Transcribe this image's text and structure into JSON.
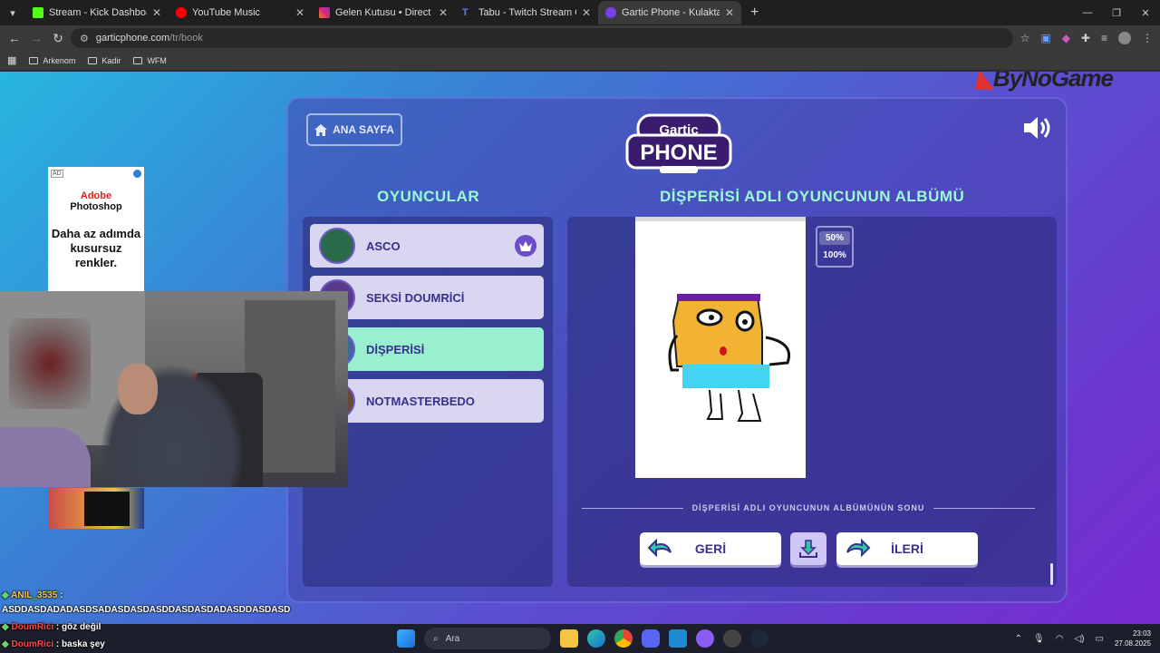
{
  "browser": {
    "tabs": [
      {
        "title": "Stream - Kick Dashboard",
        "color": "#53fc18"
      },
      {
        "title": "YouTube Music",
        "color": "#ff0000"
      },
      {
        "title": "Gelen Kutusu • Direct",
        "color": "#d62976"
      },
      {
        "title": "Tabu - Twitch Stream Games",
        "color": "#3a5bd9"
      },
      {
        "title": "Gartic Phone - Kulaktan Kulağa",
        "color": "#7b3fe4"
      }
    ],
    "url_host": "garticphone.com",
    "url_path": "/tr/book",
    "bookmarks": [
      "Arkenom",
      "Kadir",
      "WFM"
    ]
  },
  "overlay": {
    "sponsor": "ByNoGame",
    "ad": {
      "badge": "AD",
      "brand_line1": "Adobe",
      "brand_line2": "Photoshop",
      "copy": "Daha az adımda kusursuz renkler."
    },
    "chat": [
      {
        "user": "ANIL_3535",
        "sep": " :",
        "message": "ASDDASDADADASDSADASDASDASDDASDASDADASDDASDASD"
      },
      {
        "user": "DoumRici",
        "sep": " : ",
        "message": "göz değil"
      },
      {
        "user": "DoumRici",
        "sep": " : ",
        "message": "baska şey"
      }
    ]
  },
  "game": {
    "home_label": "ANA SAYFA",
    "logo_top": "Gartic",
    "logo_bottom": "PHONE",
    "players_heading": "OYUNCULAR",
    "album_heading": "DİŞPERİSİ ADLI OYUNCUNUN ALBÜMÜ",
    "players": [
      {
        "name": "ASCO",
        "host": true,
        "active": false
      },
      {
        "name": "SEKSİ DOUMRİCİ",
        "host": false,
        "active": false
      },
      {
        "name": "DİŞPERİSİ",
        "host": false,
        "active": true
      },
      {
        "name": "NOTMASTERBEDO",
        "host": false,
        "active": false
      }
    ],
    "zoom_options": [
      "50%",
      "100%"
    ],
    "album_end": "DİŞPERİSİ ADLI OYUNCUNUN ALBÜMÜNÜN SONU",
    "back_label": "GERİ",
    "next_label": "İLERİ"
  },
  "taskbar": {
    "search_placeholder": "Ara",
    "time": "23:03",
    "date": "27.08.2025"
  },
  "colors": {
    "accent_mint": "#9bf8d4",
    "active_player": "#98f0cf",
    "brand_purple": "#3a2f8a"
  }
}
